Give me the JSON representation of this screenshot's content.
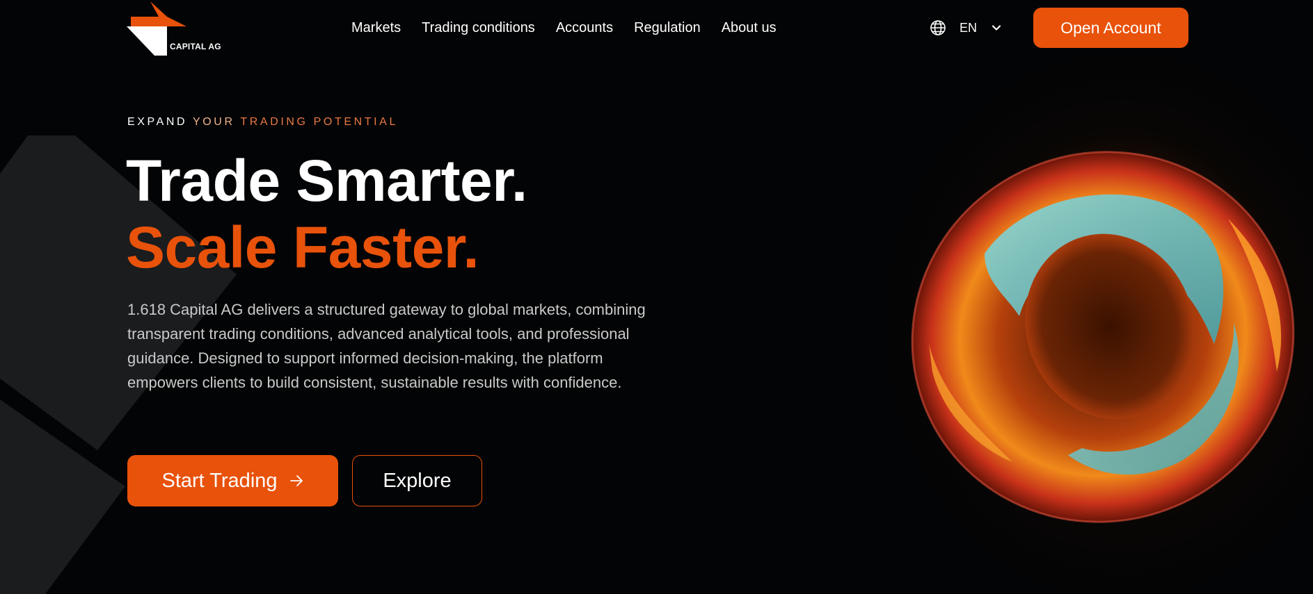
{
  "brand": {
    "name": "CAPITAL AG",
    "accent_color": "#e8520a"
  },
  "nav": {
    "items": [
      {
        "label": "Markets"
      },
      {
        "label": "Trading conditions"
      },
      {
        "label": "Accounts"
      },
      {
        "label": "Regulation"
      },
      {
        "label": "About us"
      }
    ]
  },
  "language": {
    "icon": "globe-icon",
    "selected": "EN",
    "dropdown_icon": "chevron-down-icon"
  },
  "header": {
    "open_account_label": "Open Account"
  },
  "hero": {
    "eyebrow": {
      "part1": "EXPAND",
      "part2": "YOUR",
      "part3": "TRADING POTENTIAL"
    },
    "headline_line1": "Trade Smarter.",
    "headline_line2": "Scale Faster.",
    "description": "1.618 Capital AG delivers a structured gateway to global markets, combining transparent trading conditions, advanced analytical tools, and professional guidance. Designed to support informed decision-making, the platform empowers clients to build consistent, sustainable results with confidence.",
    "primary_button": {
      "label": "Start Trading",
      "icon": "arrow-right-icon"
    },
    "secondary_button": {
      "label": "Explore"
    },
    "visual": "glowing-torus-image"
  }
}
